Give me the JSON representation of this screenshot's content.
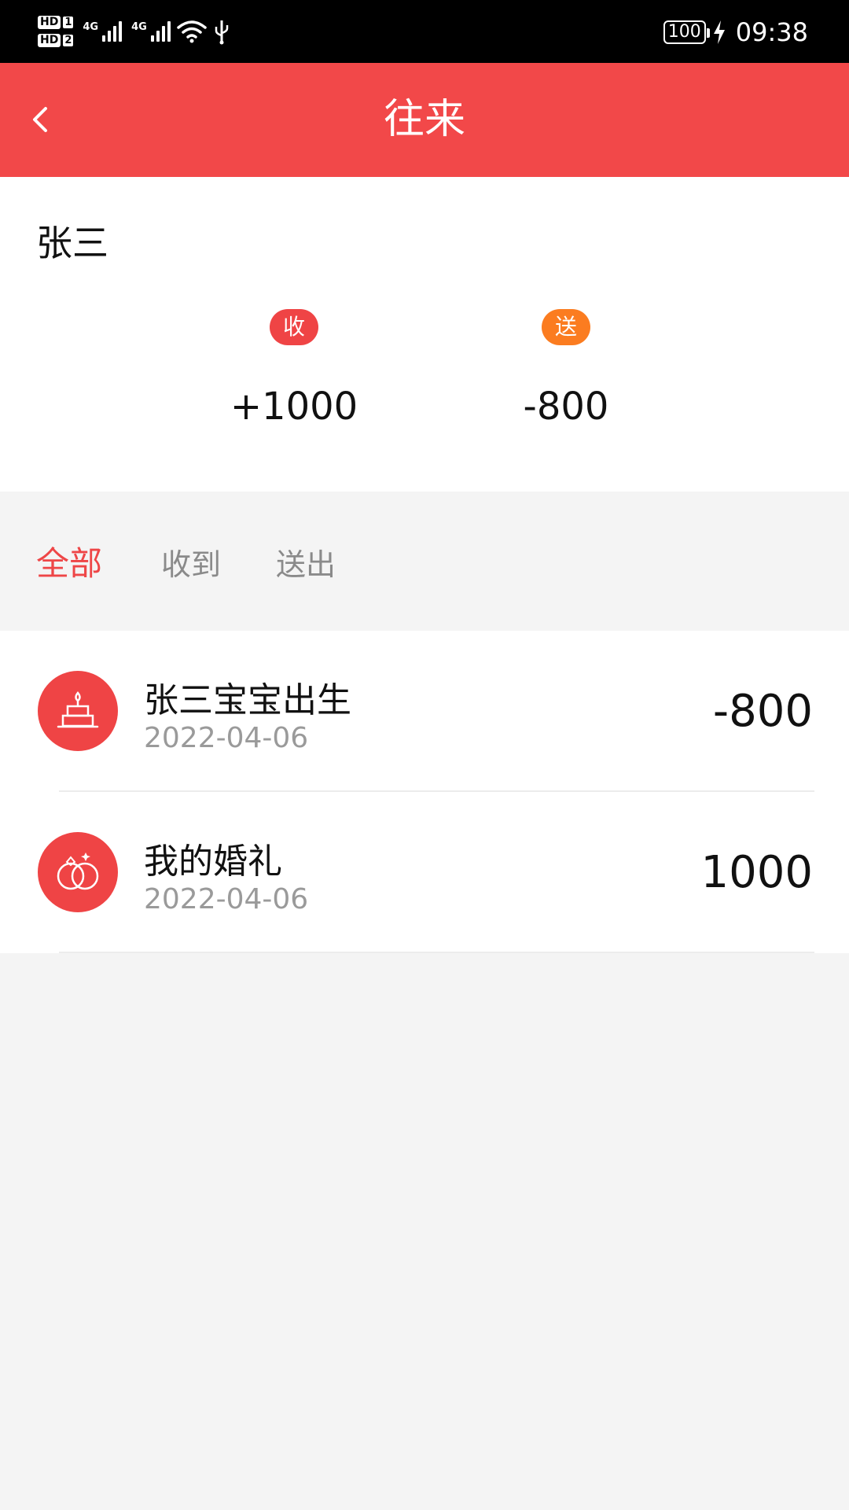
{
  "status_bar": {
    "hd1": "HD",
    "hd1_num": "1",
    "hd2": "HD",
    "hd2_num": "2",
    "net1": "4G",
    "net2": "4G",
    "battery": "100",
    "time": "09:38"
  },
  "header": {
    "title": "往来",
    "back_icon": "chevron-left-icon"
  },
  "summary": {
    "name": "张三",
    "received_badge": "收",
    "received_value": "+1000",
    "sent_badge": "送",
    "sent_value": "-800",
    "colors": {
      "received": "#ef4445",
      "sent": "#fb7c20"
    }
  },
  "tabs": [
    {
      "label": "全部",
      "active": true
    },
    {
      "label": "收到",
      "active": false
    },
    {
      "label": "送出",
      "active": false
    }
  ],
  "records": [
    {
      "icon": "birthday-cake-icon",
      "title": "张三宝宝出生",
      "date": "2022-04-06",
      "amount": "-800"
    },
    {
      "icon": "wedding-rings-icon",
      "title": "我的婚礼",
      "date": "2022-04-06",
      "amount": "1000"
    }
  ],
  "colors": {
    "accent": "#f24849",
    "background": "#f4f4f4"
  }
}
